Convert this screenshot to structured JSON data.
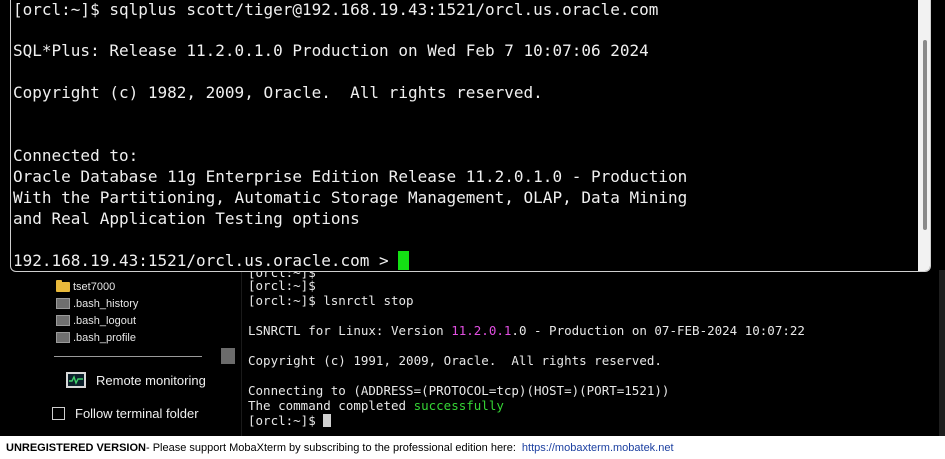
{
  "foreground_terminal": {
    "lines": [
      "[orcl:~]$ sqlplus scott/tiger@192.168.19.43:1521/orcl.us.oracle.com",
      "SQL*Plus: Release 11.2.0.1.0 Production on Wed Feb 7 10:07:06 2024",
      "Copyright (c) 1982, 2009, Oracle.  All rights reserved.",
      "Connected to:",
      "Oracle Database 11g Enterprise Edition Release 11.2.0.1.0 - Production",
      "With the Partitioning, Automatic Storage Management, OLAP, Data Mining",
      "and Real Application Testing options",
      "192.168.19.43:1521/orcl.us.oracle.com > "
    ],
    "cursor_color": "#14e014"
  },
  "sidebar": {
    "files": [
      {
        "name": "tset7000",
        "type": "folder"
      },
      {
        "name": ".bash_history",
        "type": "file"
      },
      {
        "name": ".bash_logout",
        "type": "file"
      },
      {
        "name": ".bash_profile",
        "type": "file"
      }
    ],
    "remote_monitoring_label": "Remote monitoring",
    "follow_terminal_label": "Follow terminal folder"
  },
  "background_terminal": {
    "line0": "[orcl:~]$",
    "line1": "[orcl:~]$",
    "line2": "[orcl:~]$ lsnrctl stop",
    "line3_a": "LSNRCTL for Linux: Version ",
    "line3_b": "11.2.0.1",
    "line3_c": ".0 - Production on 07-FEB-2024 10:07:22",
    "line4": "Copyright (c) 1991, 2009, Oracle.  All rights reserved.",
    "line5": "Connecting to (ADDRESS=(PROTOCOL=tcp)(HOST=)(PORT=1521))",
    "line6_a": "The command completed ",
    "line6_b": "successfully",
    "line7": "[orcl:~]$ ",
    "highlight_colors": {
      "version": "#e04fe0",
      "success": "#35d435"
    }
  },
  "statusbar": {
    "bold_text": "UNREGISTERED VERSION",
    "message": " -  Please support MobaXterm by subscribing to the professional edition here:",
    "link": "https://mobaxterm.mobatek.net"
  }
}
